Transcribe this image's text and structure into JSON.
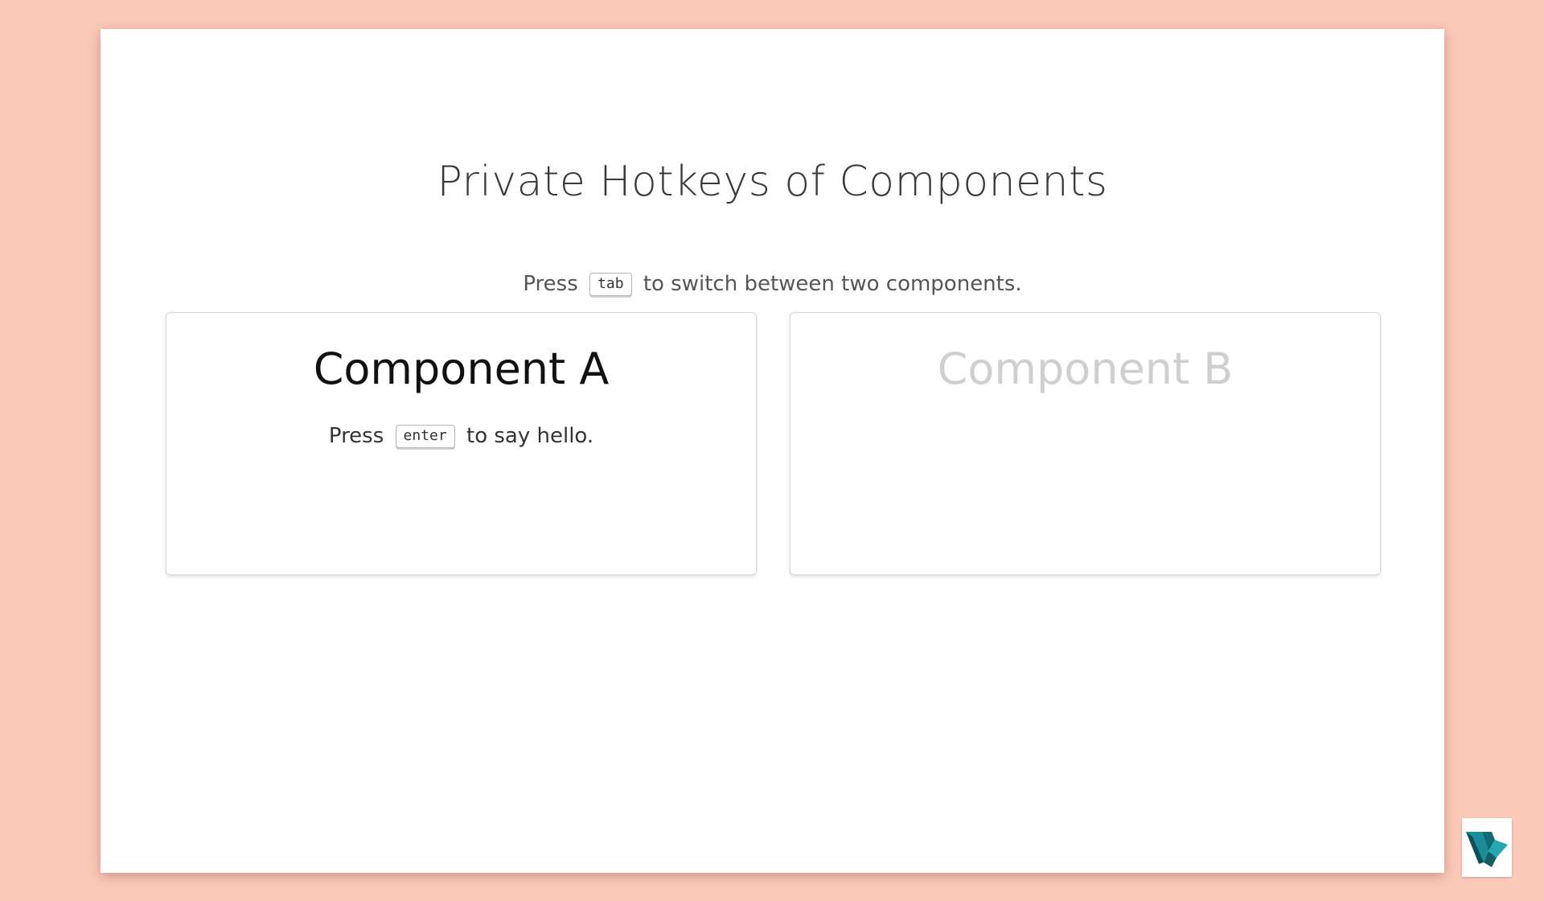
{
  "page": {
    "title": "Private Hotkeys of Components",
    "instruction_prefix": "Press",
    "instruction_key": "tab",
    "instruction_suffix": "to switch between two components."
  },
  "components": [
    {
      "title": "Component A",
      "active": true,
      "text_prefix": "Press",
      "key": "enter",
      "text_suffix": "to say hello."
    },
    {
      "title": "Component B",
      "active": false
    }
  ],
  "colors": {
    "background": "#fbc9b8",
    "active_title": "#111111",
    "inactive_title": "#cfcfcf",
    "logo_teal": "#1a8c98"
  },
  "icons": {
    "logo": "brand-logo-icon"
  }
}
